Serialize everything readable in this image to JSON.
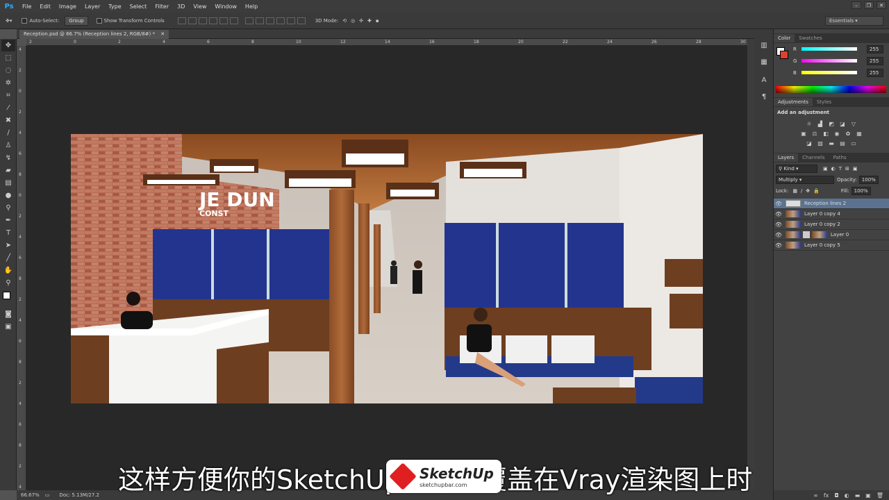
{
  "app": {
    "logo": "Ps"
  },
  "menus": [
    "File",
    "Edit",
    "Image",
    "Layer",
    "Type",
    "Select",
    "Filter",
    "3D",
    "View",
    "Window",
    "Help"
  ],
  "options": {
    "auto_select": "Auto-Select:",
    "group": "Group",
    "show_transform": "Show Transform Controls",
    "mode_3d": "3D Mode:",
    "workspace": "Essentials"
  },
  "document": {
    "tab_title": "Reception.psd @ 66.7% (Reception lines 2, RGB/8#) *",
    "zoom": "66.67%",
    "doc_size": "Doc: 5.13M/27.2"
  },
  "rulers": {
    "top": [
      "2",
      "0",
      "2",
      "4",
      "6",
      "8",
      "10",
      "12",
      "14",
      "16",
      "18",
      "20",
      "22",
      "24",
      "26",
      "28",
      "30"
    ],
    "left": [
      "4",
      "2",
      "0",
      "2",
      "4",
      "6",
      "8",
      "0",
      "2",
      "4",
      "6",
      "8",
      "2",
      "4",
      "6",
      "8",
      "2",
      "4",
      "6",
      "8",
      "2",
      "4"
    ]
  },
  "color_panel": {
    "tabs": [
      "Color",
      "Swatches"
    ],
    "channels": [
      {
        "label": "R",
        "value": "255",
        "color": "#e44"
      },
      {
        "label": "G",
        "value": "255",
        "color": "#d4d"
      },
      {
        "label": "B",
        "value": "255",
        "color": "#dd4"
      }
    ]
  },
  "adjustments_panel": {
    "tabs": [
      "Adjustments",
      "Styles"
    ],
    "title": "Add an adjustment"
  },
  "layers_panel": {
    "tabs": [
      "Layers",
      "Channels",
      "Paths"
    ],
    "kind": "Kind",
    "blend_mode": "Multiply",
    "opacity_label": "Opacity:",
    "opacity": "100%",
    "lock_label": "Lock:",
    "fill_label": "Fill:",
    "fill": "100%",
    "layers": [
      {
        "name": "Reception lines 2",
        "selected": true
      },
      {
        "name": "Layer 0 copy 4",
        "selected": false
      },
      {
        "name": "Layer 0 copy 2",
        "selected": false
      },
      {
        "name": "Layer 0",
        "selected": false
      },
      {
        "name": "Layer 0 copy 5",
        "selected": false
      }
    ]
  },
  "render": {
    "sign_line1": "JE DUN",
    "sign_line2": "CONST"
  },
  "subtitle": "这样方便你的SketchUp线描图覆盖在Vray渲染图上时",
  "watermark": {
    "brand": "SketchUp",
    "url": "sketchupbar.com"
  }
}
